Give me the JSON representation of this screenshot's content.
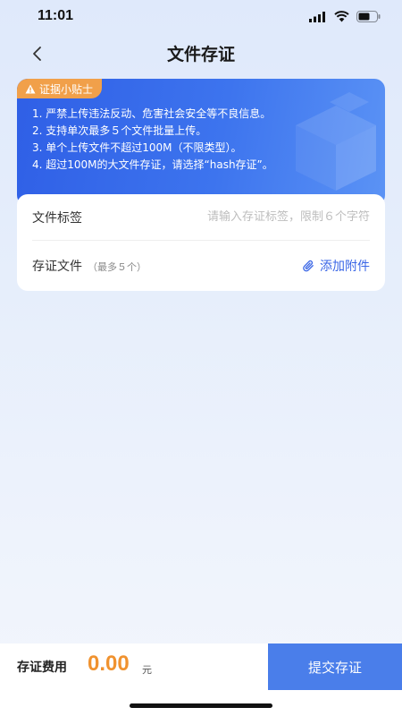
{
  "status_bar": {
    "time": "11:01"
  },
  "nav": {
    "title": "文件存证"
  },
  "tips": {
    "badge": "证据小贴士",
    "items": [
      "1. 严禁上传违法反动、危害社会安全等不良信息。",
      "2. 支持单次最多５个文件批量上传。",
      "3. 单个上传文件不超过100M（不限类型）。",
      "4. 超过100M的大文件存证，请选择“hash存证”。"
    ]
  },
  "form": {
    "tag_label": "文件标签",
    "tag_placeholder": "请输入存证标签，限制６个字符",
    "file_label": "存证文件",
    "file_hint": "（最多５个）",
    "attach_label": "添加附件"
  },
  "footer": {
    "fee_label": "存证费用",
    "fee_amount": "0.00",
    "fee_unit": "元",
    "submit_label": "提交存证"
  },
  "colors": {
    "accent": "#4a7eea",
    "badge": "#f1a04a",
    "fee": "#f0922f"
  },
  "icons": [
    "back-arrow-icon",
    "signal-icon",
    "wifi-icon",
    "battery-icon",
    "warning-icon",
    "paperclip-icon"
  ]
}
